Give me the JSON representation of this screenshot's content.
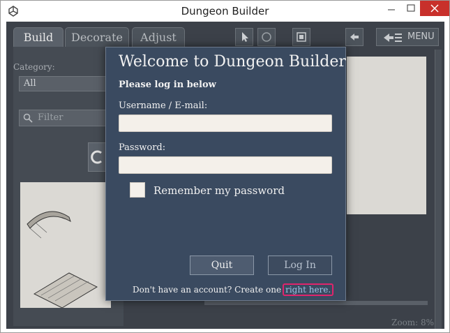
{
  "window": {
    "title": "Dungeon Builder"
  },
  "tabs": [
    {
      "label": "Build"
    },
    {
      "label": "Decorate"
    },
    {
      "label": "Adjust"
    }
  ],
  "sidebar": {
    "category_label": "Category:",
    "category_value": "All",
    "filter_placeholder": "Filter"
  },
  "toolbar": {
    "menu_label": "MENU"
  },
  "status": {
    "zoom": "Zoom: 8%"
  },
  "dialog": {
    "title": "Welcome to Dungeon Builder",
    "subtitle": "Please log in below",
    "username_label": "Username / E-mail:",
    "username_value": "",
    "password_label": "Password:",
    "password_value": "",
    "remember_label": "Remember my password",
    "quit_label": "Quit",
    "login_label": "Log In",
    "account_text": "Don't have an account? Create one",
    "account_link": "right here."
  },
  "colors": {
    "dialog_bg": "#3a4a60",
    "app_bg": "#3c4149",
    "highlight": "#e0246c",
    "close_btn": "#c8302b"
  }
}
